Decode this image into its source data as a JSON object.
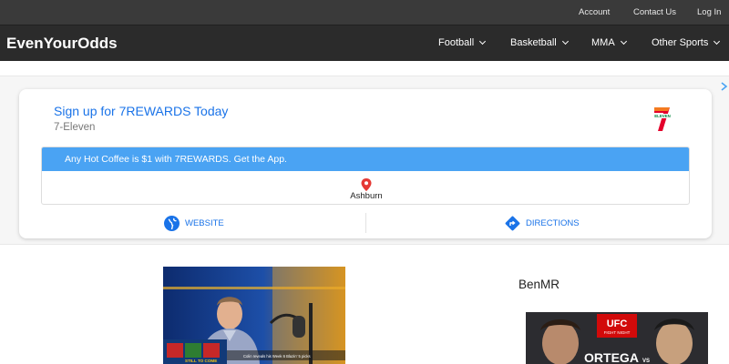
{
  "topbar": {
    "links": [
      "Account",
      "Contact Us",
      "Log In"
    ]
  },
  "navbar": {
    "brand": "EvenYourOdds",
    "items": [
      "Football",
      "Basketball",
      "MMA",
      "Other Sports"
    ]
  },
  "ad": {
    "title": "Sign up for 7REWARDS Today",
    "advertiser": "7-Eleven",
    "logo_text": "ELEVEN",
    "banner": "Any Hot Coffee is $1 with 7REWARDS. Get the App.",
    "location": "Ashburn",
    "website_label": "WEBSITE",
    "directions_label": "DIRECTIONS",
    "accent_color": "#1a73e8",
    "banner_color": "#4aa3f3"
  },
  "video": {
    "caption": "Colin reveals his Week 6 Blazin' 5 picks",
    "still_to_come": "STILL TO COME"
  },
  "sidebar": {
    "title": "BenMR",
    "promo": {
      "brand": "UFC",
      "sub": "FIGHT NIGHT",
      "fighter": "ORTEGA",
      "vs": "VS"
    }
  }
}
